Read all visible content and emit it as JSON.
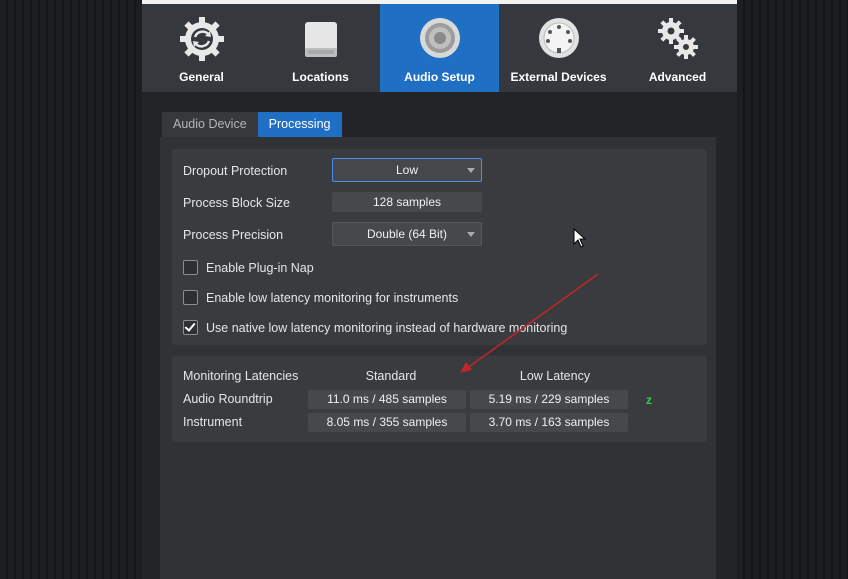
{
  "toolbar": {
    "items": [
      {
        "label": "General",
        "icon": "general-sync-gear-icon",
        "active": false
      },
      {
        "label": "Locations",
        "icon": "drive-icon",
        "active": false
      },
      {
        "label": "Audio Setup",
        "icon": "speaker-icon",
        "active": true
      },
      {
        "label": "External Devices",
        "icon": "midi-connector-icon",
        "active": false
      },
      {
        "label": "Advanced",
        "icon": "gears-icon",
        "active": false
      }
    ]
  },
  "tabs": [
    {
      "label": "Audio Device",
      "active": false
    },
    {
      "label": "Processing",
      "active": true
    }
  ],
  "processing": {
    "dropout_protection": {
      "label": "Dropout Protection",
      "value": "Low"
    },
    "process_block_size": {
      "label": "Process Block Size",
      "value": "128 samples"
    },
    "process_precision": {
      "label": "Process Precision",
      "value": "Double (64 Bit)"
    },
    "checkboxes": [
      {
        "label": "Enable Plug-in Nap",
        "checked": false
      },
      {
        "label": "Enable low latency monitoring for instruments",
        "checked": false
      },
      {
        "label": "Use native low latency monitoring instead of hardware monitoring",
        "checked": true
      }
    ]
  },
  "latencies": {
    "title": "Monitoring Latencies",
    "col_standard": "Standard",
    "col_low": "Low Latency",
    "rows": [
      {
        "label": "Audio Roundtrip",
        "standard": "11.0 ms / 485 samples",
        "low": "5.19 ms / 229 samples"
      },
      {
        "label": "Instrument",
        "standard": "8.05 ms / 355 samples",
        "low": "3.70 ms / 163 samples"
      }
    ],
    "status_glyph": "z"
  },
  "colors": {
    "accent": "#1f6fc4",
    "annotation_arrow": "#c0262a",
    "status_green": "#2fcf48"
  }
}
